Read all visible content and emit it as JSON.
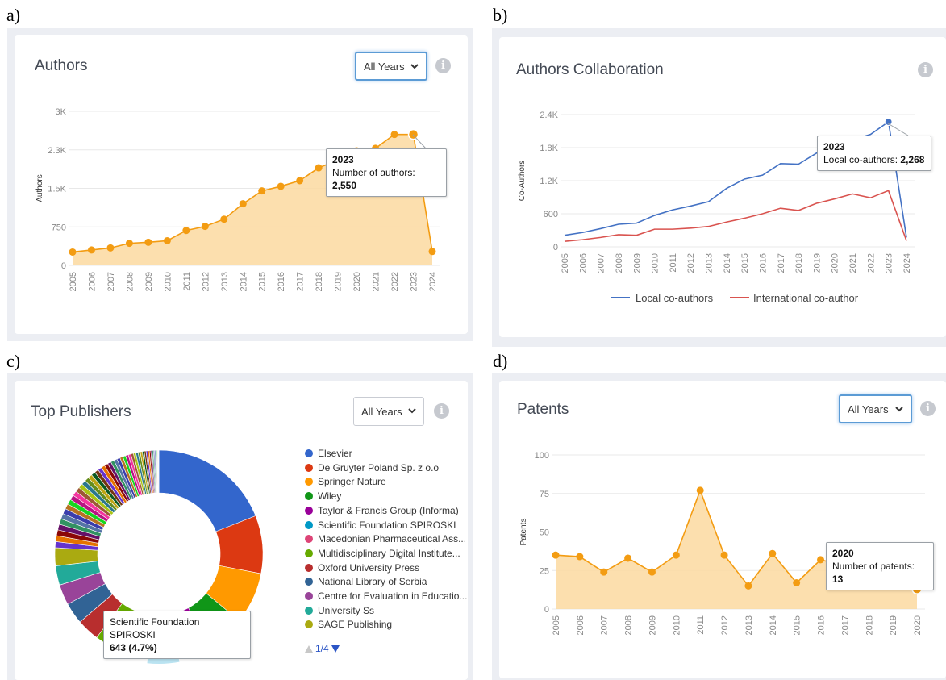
{
  "panels": {
    "a": {
      "letter": "a)",
      "title": "Authors",
      "select": "All Years",
      "info": "i",
      "tooltip": {
        "year": "2023",
        "label": "Number of authors:",
        "value": "2,550"
      }
    },
    "b": {
      "letter": "b)",
      "title": "Authors Collaboration",
      "info": "i",
      "tooltip": {
        "year": "2023",
        "label": "Local co-authors:",
        "value": "2,268"
      }
    },
    "c": {
      "letter": "c)",
      "title": "Top Publishers",
      "select": "All Years",
      "info": "i",
      "tooltip": {
        "name": "Scientific Foundation SPIROSKI",
        "value": "643 (4.7%)"
      },
      "pager": "1/4"
    },
    "d": {
      "letter": "d)",
      "title": "Patents",
      "select": "All Years",
      "info": "i",
      "tooltip": {
        "year": "2020",
        "label": "Number of patents:",
        "value": "13"
      }
    }
  },
  "colors": {
    "orange": "#f39c12",
    "orange_fill": "#fcd9a0",
    "blue": "#4472c4",
    "red": "#d9534f",
    "grid": "#e8e8e8",
    "axis_text": "#888888"
  },
  "chart_data": [
    {
      "type": "area",
      "ylabel": "Authors",
      "ylim": [
        0,
        3000
      ],
      "yticks": [
        0,
        750,
        1500,
        2250,
        3000
      ],
      "ytick_labels": [
        "0",
        "750",
        "1.5K",
        "2.3K",
        "3K"
      ],
      "x": [
        "2005",
        "2006",
        "2007",
        "2008",
        "2009",
        "2010",
        "2011",
        "2012",
        "2013",
        "2014",
        "2015",
        "2016",
        "2017",
        "2018",
        "2019",
        "2020",
        "2021",
        "2022",
        "2023",
        "2024"
      ],
      "series": [
        {
          "values": [
            260,
            300,
            340,
            430,
            450,
            480,
            680,
            760,
            900,
            1200,
            1450,
            1540,
            1650,
            1900,
            2050,
            2230,
            2280,
            2550,
            2550,
            270
          ]
        }
      ],
      "grid": true
    },
    {
      "type": "line",
      "ylabel": "Co-Authors",
      "ylim": [
        0,
        2400
      ],
      "yticks": [
        0,
        600,
        1200,
        1800,
        2400
      ],
      "ytick_labels": [
        "0",
        "600",
        "1.2K",
        "1.8K",
        "2.4K"
      ],
      "x": [
        "2005",
        "2006",
        "2007",
        "2008",
        "2009",
        "2010",
        "2011",
        "2012",
        "2013",
        "2014",
        "2015",
        "2016",
        "2017",
        "2018",
        "2019",
        "2020",
        "2021",
        "2022",
        "2023",
        "2024"
      ],
      "series": [
        {
          "name": "Local co-authors",
          "values": [
            210,
            260,
            330,
            410,
            430,
            570,
            670,
            740,
            820,
            1060,
            1230,
            1300,
            1510,
            1500,
            1700,
            1900,
            1940,
            2040,
            2268,
            170
          ]
        },
        {
          "name": "International co-author",
          "values": [
            100,
            130,
            170,
            220,
            210,
            320,
            320,
            340,
            370,
            450,
            520,
            600,
            700,
            660,
            790,
            870,
            960,
            890,
            1020,
            110
          ]
        }
      ],
      "legend": "bottom",
      "grid": true
    },
    {
      "type": "pie",
      "donut": true,
      "slices": [
        {
          "name": "Elsevier",
          "value": 19
        },
        {
          "name": "De Gruyter Poland Sp. z o.o",
          "value": 9
        },
        {
          "name": "Springer Nature",
          "value": 8
        },
        {
          "name": "Wiley",
          "value": 6
        },
        {
          "name": "Taylor & Francis Group (Informa)",
          "value": 5
        },
        {
          "name": "Scientific Foundation SPIROSKI",
          "value": 4.7
        },
        {
          "name": "Macedonian Pharmaceutical Ass...",
          "value": 4.5
        },
        {
          "name": "Multidisciplinary Digital Institute...",
          "value": 4
        },
        {
          "name": "Oxford University Press",
          "value": 3.5
        },
        {
          "name": "National Library of Serbia",
          "value": 3.3
        },
        {
          "name": "Centre for Evaluation in Educatio...",
          "value": 3.2
        },
        {
          "name": "University Ss",
          "value": 3
        },
        {
          "name": "SAGE Publishing",
          "value": 2.8
        }
      ],
      "other_small_slices": 50,
      "legend": "right"
    },
    {
      "type": "area",
      "ylabel": "Patents",
      "ylim": [
        0,
        100
      ],
      "yticks": [
        0,
        25,
        50,
        75,
        100
      ],
      "ytick_labels": [
        "0",
        "25",
        "50",
        "75",
        "100"
      ],
      "x": [
        "2005",
        "2006",
        "2007",
        "2008",
        "2009",
        "2010",
        "2011",
        "2012",
        "2013",
        "2014",
        "2015",
        "2016",
        "2017",
        "2018",
        "2019",
        "2020"
      ],
      "series": [
        {
          "values": [
            35,
            34,
            24,
            33,
            24,
            35,
            77,
            35,
            15,
            36,
            17,
            32,
            28,
            30,
            29,
            13
          ]
        }
      ],
      "grid": true
    }
  ]
}
